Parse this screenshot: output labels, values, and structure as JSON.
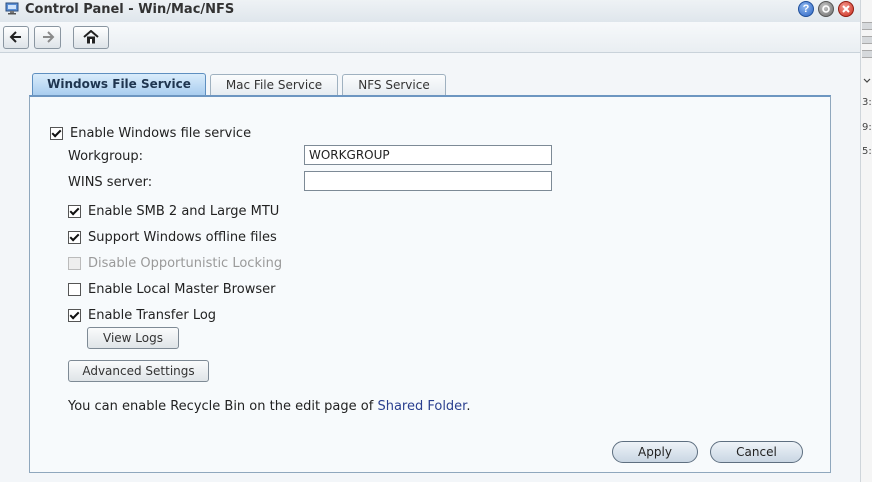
{
  "window": {
    "title": "Control Panel - Win/Mac/NFS"
  },
  "window_controls": {
    "help": "?",
    "minimize": "",
    "close": ""
  },
  "tabs": [
    {
      "label": "Windows File Service",
      "active": true
    },
    {
      "label": "Mac File Service",
      "active": false
    },
    {
      "label": "NFS Service",
      "active": false
    }
  ],
  "windows_service": {
    "enable_label": "Enable Windows file service",
    "enable_checked": true,
    "workgroup_label": "Workgroup:",
    "workgroup_value": "WORKGROUP",
    "wins_label": "WINS server:",
    "wins_value": "",
    "options": [
      {
        "label": "Enable SMB 2 and Large MTU",
        "checked": true,
        "disabled": false
      },
      {
        "label": "Support Windows offline files",
        "checked": true,
        "disabled": false
      },
      {
        "label": "Disable Opportunistic Locking",
        "checked": false,
        "disabled": true
      },
      {
        "label": "Enable Local Master Browser",
        "checked": false,
        "disabled": false
      },
      {
        "label": "Enable Transfer Log",
        "checked": true,
        "disabled": false
      }
    ],
    "view_logs_label": "View Logs",
    "advanced_settings_label": "Advanced Settings",
    "note_prefix": "You can enable Recycle Bin on the edit page of ",
    "note_link": "Shared Folder",
    "note_suffix": "."
  },
  "footer": {
    "apply_label": "Apply",
    "cancel_label": "Cancel"
  },
  "edge_fragments": [
    "3:",
    "9:",
    "5:"
  ],
  "colors": {
    "tab_active": "#a9cdef",
    "panel_border": "#6d96c1",
    "link": "#2a3f8f"
  }
}
